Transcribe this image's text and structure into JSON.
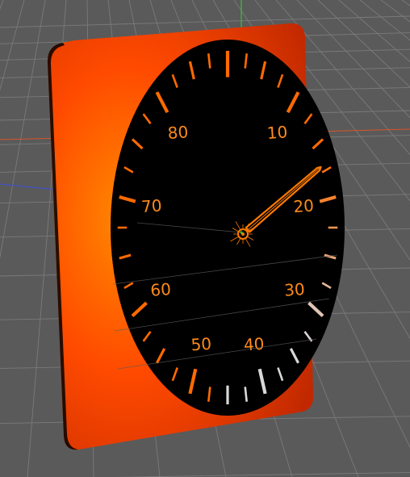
{
  "viewport": {
    "background": "#5a5a5a",
    "grid_color": "#7a7a7a",
    "axis_colors": {
      "x": "#d9532b",
      "y": "#35c13a",
      "z": "#3b4fe0"
    }
  },
  "backplate": {
    "color_center": "#ff8a00",
    "color_mid": "#ff4a00",
    "color_edge": "#c12800"
  },
  "gauge": {
    "face_color": "#000000",
    "scale_labels": [
      "10",
      "20",
      "30",
      "40",
      "50",
      "60",
      "70",
      "80"
    ],
    "label_color": "#ff8a1a",
    "needle_color": "#ff7a00",
    "needle_value": 17,
    "tick_gradient": {
      "orange": "#ff6a00",
      "white": "#d8d8d8"
    }
  }
}
